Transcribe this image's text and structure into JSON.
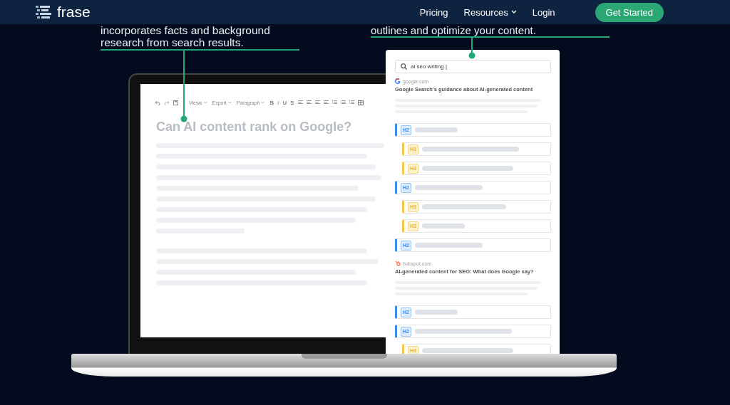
{
  "header": {
    "logo": "frase",
    "nav": [
      {
        "label": "Pricing",
        "dropdown": false
      },
      {
        "label": "Resources",
        "dropdown": true
      },
      {
        "label": "Login",
        "dropdown": false
      }
    ],
    "cta": "Get Started"
  },
  "captions": [
    {
      "lines": [
        "incorporates facts and background",
        "research from search results."
      ]
    },
    {
      "lines": [
        "outlines and optimize your content."
      ]
    }
  ],
  "editor": {
    "toolbar": {
      "menus": [
        "Views",
        "Export",
        "Paragraph"
      ],
      "format": [
        "B",
        "I",
        "U",
        "S"
      ]
    },
    "title": "Can AI content rank on Google?"
  },
  "panel": {
    "search": {
      "value": "ai seo writing |"
    },
    "sources": [
      {
        "domain": "google.com",
        "title": "Google Search's guidance about AI-generated content",
        "outline": [
          {
            "kind": "h2",
            "label": "H2"
          },
          {
            "kind": "h3",
            "label": "H3"
          },
          {
            "kind": "h3",
            "label": "H3"
          },
          {
            "kind": "h2",
            "label": "H2"
          },
          {
            "kind": "h3",
            "label": "H3"
          },
          {
            "kind": "h3",
            "label": "H3"
          },
          {
            "kind": "h2",
            "label": "H2"
          }
        ]
      },
      {
        "domain": "hubspot.com",
        "title": "AI-generated content for SEO: What does Google say?",
        "outline": [
          {
            "kind": "h2",
            "label": "H2"
          },
          {
            "kind": "h2",
            "label": "H2"
          },
          {
            "kind": "h3",
            "label": "H3"
          }
        ]
      }
    ]
  }
}
